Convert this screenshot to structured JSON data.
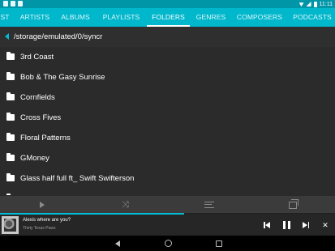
{
  "status_bar": {
    "time": "11:11"
  },
  "tabs": [
    {
      "label": "ST"
    },
    {
      "label": "ARTISTS"
    },
    {
      "label": "ALBUMS"
    },
    {
      "label": "PLAYLISTS"
    },
    {
      "label": "FOLDERS",
      "active": true
    },
    {
      "label": "GENRES"
    },
    {
      "label": "COMPOSERS"
    },
    {
      "label": "PODCASTS"
    }
  ],
  "path": {
    "text": "/storage/emulated/0/syncr"
  },
  "folders": [
    {
      "name": "3rd Coast"
    },
    {
      "name": "Bob & The Gasy Sunrise"
    },
    {
      "name": "Cornfields"
    },
    {
      "name": "Cross Fives"
    },
    {
      "name": "Floral Patterns"
    },
    {
      "name": "GMoney"
    },
    {
      "name": "Glass half full ft_ Swift Swifterson"
    }
  ],
  "controls": {
    "icons": [
      "play-icon",
      "shuffle-icon",
      "queue-icon",
      "cast-icon"
    ]
  },
  "now_playing": {
    "title": "Alexis where are you?",
    "artist": "Thirty Texas Paws",
    "progress": 0.55
  },
  "colors": {
    "accent": "#00b7cc",
    "status_bar": "#0096a8",
    "list_bg": "#2b2b2b",
    "controls_bg": "#3b3b3b"
  }
}
